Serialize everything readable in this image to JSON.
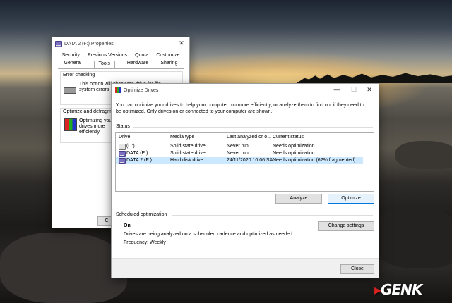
{
  "properties": {
    "title": "DATA 2 (F:) Properties",
    "tabs_row1": [
      "Security",
      "Previous Versions",
      "Quota",
      "Customize"
    ],
    "tabs_row2": [
      "General",
      "Tools",
      "Hardware",
      "Sharing"
    ],
    "error_checking": {
      "heading": "Error checking",
      "text": "This option will check the drive for file system errors"
    },
    "optimize": {
      "heading": "Optimize and defragment d",
      "text": "Optimizing your drives more efficiently"
    },
    "ok_fragment": "C"
  },
  "optimize": {
    "title": "Optimize Drives",
    "description": "You can optimize your drives to help your computer run more efficiently, or analyze them to find out if they need to be optimized. Only drives on or connected to your computer are shown.",
    "status_label": "Status",
    "columns": [
      "Drive",
      "Media type",
      "Last analyzed or o...",
      "Current status"
    ],
    "drives": [
      {
        "name": "(C:)",
        "media": "Solid state drive",
        "last": "Never run",
        "status": "Needs optimization"
      },
      {
        "name": "DATA (E:)",
        "media": "Solid state drive",
        "last": "Never run",
        "status": "Needs optimization"
      },
      {
        "name": "DATA 2 (F:)",
        "media": "Hard disk drive",
        "last": "24/11/2020 10:06 SA",
        "status": "Needs optimization (62% fragmented)"
      }
    ],
    "analyze_label": "Analyze",
    "optimize_label": "Optimize",
    "scheduled_label": "Scheduled optimization",
    "sched_state": "On",
    "sched_text": "Drives are being analyzed on a scheduled cadence and optimized as needed.",
    "frequency": "Frequency: Weekly",
    "change_settings_label": "Change settings",
    "close_label": "Close"
  },
  "watermark": "GENK",
  "colors": {
    "accent": "#0078d7",
    "selected_row": "#cce8ff",
    "watermark_red": "#d7231f"
  }
}
